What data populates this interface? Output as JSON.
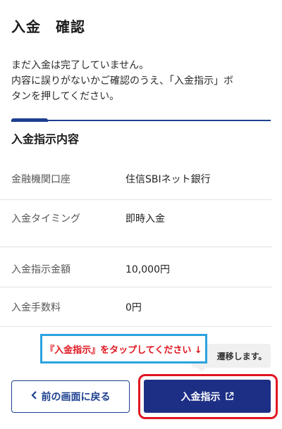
{
  "page": {
    "title": "入金　確認"
  },
  "notice": {
    "line1": "まだ入金は完了していません。",
    "line2": "内容に誤りがないかご確認のうえ、「入金指示」ボ",
    "line3": "タンを押してください。"
  },
  "section": {
    "title": "入金指示内容"
  },
  "details": [
    {
      "label": "金融機関口座",
      "value": "住信SBIネット銀行"
    },
    {
      "label": "入金タイミング",
      "value": "即時入金"
    },
    {
      "label": "入金指示金額",
      "value": "10,000円"
    },
    {
      "label": "入金手数料",
      "value": "0円"
    }
  ],
  "tooltip": {
    "text": "遷移します。"
  },
  "callout": {
    "text": "『入金指示』をタップしてください ↓"
  },
  "buttons": {
    "back_label": "前の画面に戻る",
    "back_icon": "chevron-left-icon",
    "submit_label": "入金指示",
    "submit_icon": "external-link-icon"
  },
  "colors": {
    "primary": "#1d2f85",
    "highlight": "#e0151f",
    "callout_border": "#2ba3df"
  }
}
